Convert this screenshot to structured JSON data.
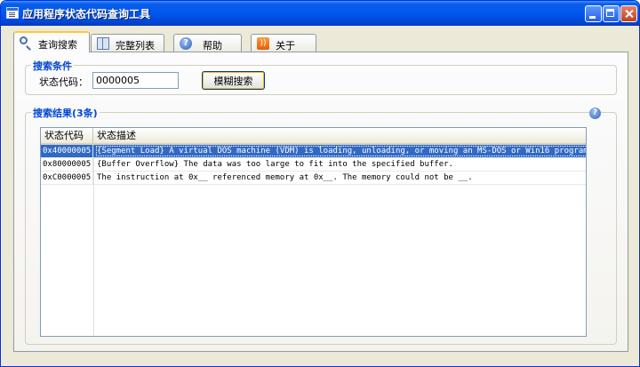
{
  "window": {
    "title": "应用程序状态代码查询工具"
  },
  "tabs": [
    {
      "label": "查询搜索",
      "icon": "magnifier-icon",
      "active": true
    },
    {
      "label": "完整列表",
      "icon": "book-icon",
      "active": false
    },
    {
      "label": "帮助",
      "icon": "help-icon",
      "active": false
    },
    {
      "label": "关于",
      "icon": "rss-icon",
      "active": false
    }
  ],
  "search": {
    "group_title": "搜索条件",
    "code_label": "状态代码：",
    "code_value": "0000005",
    "fuzzy_button": "模糊搜索"
  },
  "results": {
    "group_title": "搜索结果(3条)",
    "columns": [
      "状态代码",
      "状态描述"
    ],
    "rows": [
      {
        "code": "0x40000005",
        "desc": "{Segment Load} A virtual DOS machine (VDM) is loading, unloading, or moving an MS-DOS or Win16 program...",
        "selected": true
      },
      {
        "code": "0x80000005",
        "desc": "{Buffer Overflow} The data was too large to fit into the specified buffer.",
        "selected": false
      },
      {
        "code": "0xC0000005",
        "desc": "The instruction at 0x__ referenced memory at 0x__. The memory could not be __.",
        "selected": false
      }
    ]
  },
  "colors": {
    "titlebar": "#0058ee",
    "group_title": "#0046d5",
    "selection": "#316ac5",
    "active_tab_accent": "#ffc83c"
  }
}
